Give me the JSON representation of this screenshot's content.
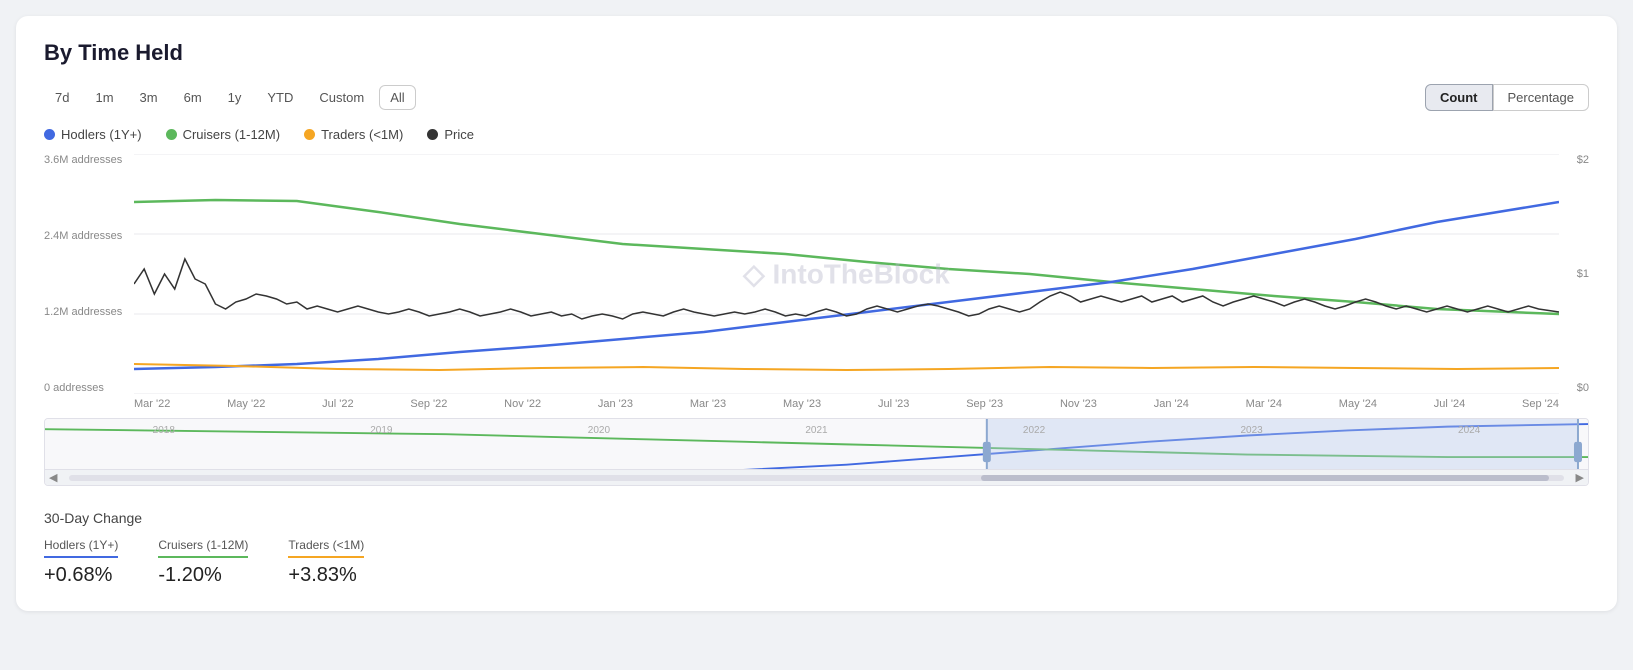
{
  "page": {
    "title": "By Time Held"
  },
  "toolbar": {
    "filters": [
      {
        "label": "7d",
        "active": false
      },
      {
        "label": "1m",
        "active": false
      },
      {
        "label": "3m",
        "active": false
      },
      {
        "label": "6m",
        "active": false
      },
      {
        "label": "1y",
        "active": false
      },
      {
        "label": "YTD",
        "active": false
      },
      {
        "label": "Custom",
        "active": false
      },
      {
        "label": "All",
        "active": true
      }
    ],
    "view_count": "Count",
    "view_percentage": "Percentage"
  },
  "legend": [
    {
      "label": "Hodlers (1Y+)",
      "color": "#4169e1"
    },
    {
      "label": "Cruisers (1-12M)",
      "color": "#5cb85c"
    },
    {
      "label": "Traders (<1M)",
      "color": "#f5a623"
    },
    {
      "label": "Price",
      "color": "#333"
    }
  ],
  "y_axis": {
    "left": [
      "3.6M addresses",
      "2.4M addresses",
      "1.2M addresses",
      "0 addresses"
    ],
    "right": [
      "$2",
      "$1",
      "$0"
    ]
  },
  "x_axis_main": [
    "Mar '22",
    "May '22",
    "Jul '22",
    "Sep '22",
    "Nov '22",
    "Jan '23",
    "Mar '23",
    "May '23",
    "Jul '23",
    "Sep '23",
    "Nov '23",
    "Jan '24",
    "Mar '24",
    "May '24",
    "Jul '24",
    "Sep '24"
  ],
  "minimap_labels": [
    "2018",
    "2019",
    "2020",
    "2021",
    "2022",
    "2023",
    "2024"
  ],
  "watermark": "◇ IntoTheBlock",
  "change_section": {
    "title": "30-Day Change",
    "items": [
      {
        "label": "Hodlers (1Y+)",
        "color": "#4169e1",
        "value": "+0.68%"
      },
      {
        "label": "Cruisers (1-12M)",
        "color": "#5cb85c",
        "value": "-1.20%"
      },
      {
        "label": "Traders (<1M)",
        "color": "#f5a623",
        "value": "+3.83%"
      }
    ]
  }
}
